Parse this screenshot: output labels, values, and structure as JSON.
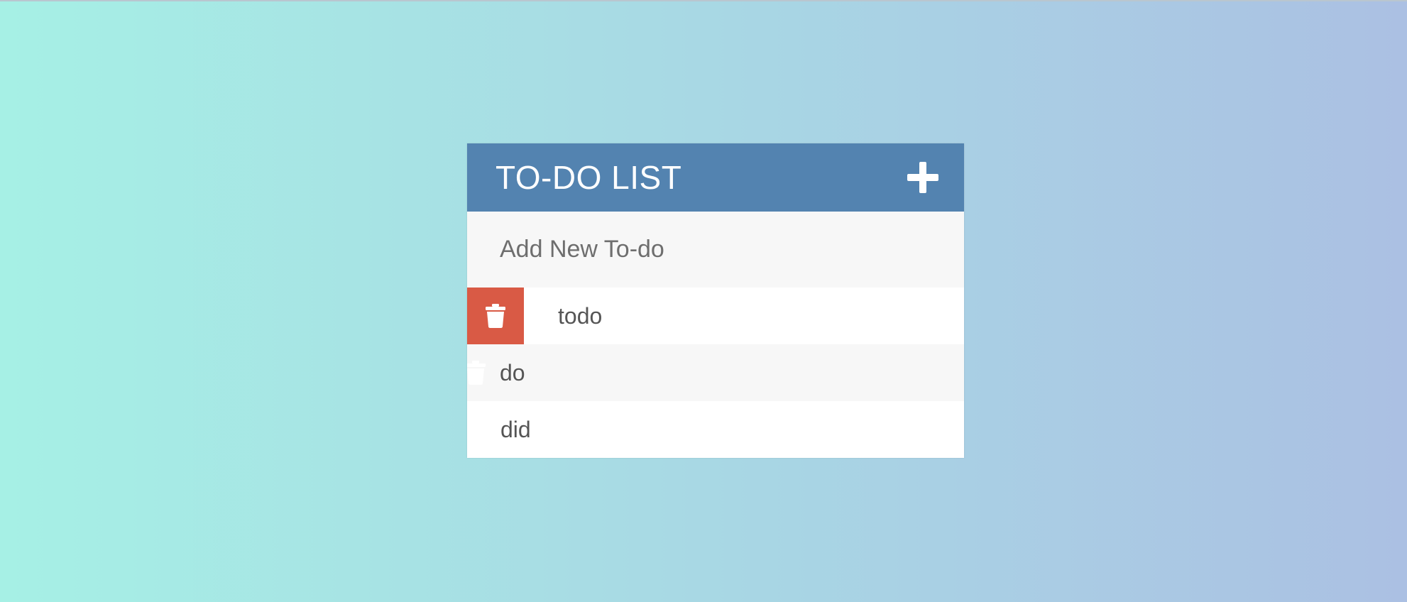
{
  "header": {
    "title": "TO-DO LIST",
    "add_icon": "plus-icon"
  },
  "new_todo": {
    "placeholder": "Add New To-do",
    "value": ""
  },
  "todos": [
    {
      "text": "todo",
      "delete_state": "revealed",
      "delete_icon": "trash-icon"
    },
    {
      "text": "do",
      "delete_state": "partially-revealed",
      "delete_icon": "trash-icon"
    },
    {
      "text": "did",
      "delete_state": "hidden",
      "delete_icon": "trash-icon"
    }
  ],
  "colors": {
    "header": "#5383b0",
    "delete": "#d95a45",
    "background_start": "#a6f0e5",
    "background_end": "#abc0e3"
  }
}
